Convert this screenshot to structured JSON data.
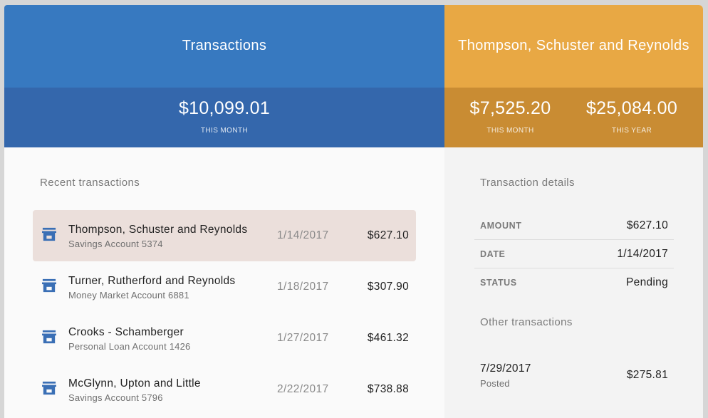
{
  "left_header": {
    "title": "Transactions",
    "amount": "$10,099.01",
    "amount_label": "THIS MONTH"
  },
  "right_header": {
    "title": "Thompson, Schuster and Reynolds",
    "month_amount": "$7,525.20",
    "month_label": "THIS MONTH",
    "year_amount": "$25,084.00",
    "year_label": "THIS YEAR"
  },
  "recent": {
    "title": "Recent transactions",
    "items": [
      {
        "name": "Thompson, Schuster and Reynolds",
        "account": "Savings Account 5374",
        "date": "1/14/2017",
        "amount": "$627.10",
        "selected": true,
        "icon": "store-icon"
      },
      {
        "name": "Turner, Rutherford and Reynolds",
        "account": "Money Market Account 6881",
        "date": "1/18/2017",
        "amount": "$307.90",
        "selected": false,
        "icon": "store-icon"
      },
      {
        "name": "Crooks - Schamberger",
        "account": "Personal Loan Account 1426",
        "date": "1/27/2017",
        "amount": "$461.32",
        "selected": false,
        "icon": "store-icon"
      },
      {
        "name": "McGlynn, Upton and Little",
        "account": "Savings Account 5796",
        "date": "2/22/2017",
        "amount": "$738.88",
        "selected": false,
        "icon": "store-icon"
      }
    ]
  },
  "details": {
    "title": "Transaction details",
    "amount_key": "AMOUNT",
    "amount_value": "$627.10",
    "date_key": "DATE",
    "date_value": "1/14/2017",
    "status_key": "STATUS",
    "status_value": "Pending"
  },
  "other": {
    "title": "Other transactions",
    "items": [
      {
        "date": "7/29/2017",
        "status": "Posted",
        "amount": "$275.81"
      }
    ]
  },
  "colors": {
    "blue_title": "#3779c0",
    "blue_stats": "#3467ac",
    "orange_title": "#e8a844",
    "orange_stats": "#c98c33",
    "selected_row": "#ebdfdb",
    "icon_blue": "#3a6fb5"
  }
}
